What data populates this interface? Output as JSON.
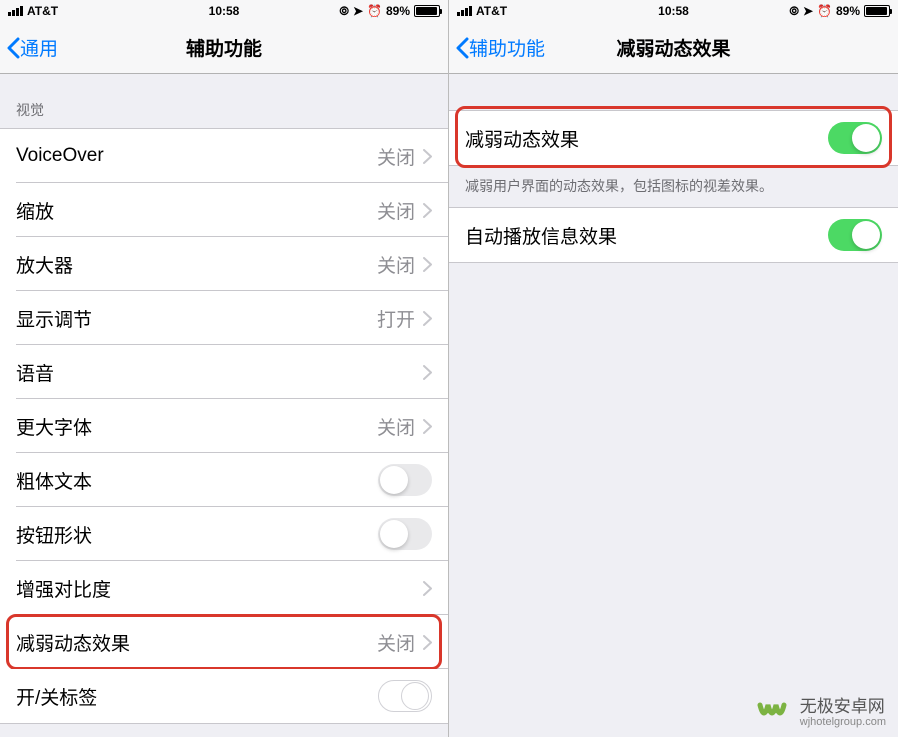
{
  "status": {
    "carrier": "AT&T",
    "time": "10:58",
    "battery_pct": "89%"
  },
  "left": {
    "back_label": "通用",
    "title": "辅助功能",
    "section": "视觉",
    "rows": [
      {
        "label": "VoiceOver",
        "value": "关闭",
        "type": "disclosure"
      },
      {
        "label": "缩放",
        "value": "关闭",
        "type": "disclosure"
      },
      {
        "label": "放大器",
        "value": "关闭",
        "type": "disclosure"
      },
      {
        "label": "显示调节",
        "value": "打开",
        "type": "disclosure"
      },
      {
        "label": "语音",
        "value": "",
        "type": "disclosure"
      },
      {
        "label": "更大字体",
        "value": "关闭",
        "type": "disclosure"
      },
      {
        "label": "粗体文本",
        "value": "",
        "type": "toggle",
        "on": false
      },
      {
        "label": "按钮形状",
        "value": "",
        "type": "toggle",
        "on": false
      },
      {
        "label": "增强对比度",
        "value": "",
        "type": "disclosure"
      },
      {
        "label": "减弱动态效果",
        "value": "关闭",
        "type": "disclosure",
        "highlight": true
      },
      {
        "label": "开/关标签",
        "value": "",
        "type": "toggle",
        "on": false,
        "outline": true
      }
    ]
  },
  "right": {
    "back_label": "辅助功能",
    "title": "减弱动态效果",
    "main_row": {
      "label": "减弱动态效果"
    },
    "footer": "减弱用户界面的动态效果，包括图标的视差效果。",
    "second_row": {
      "label": "自动播放信息效果"
    }
  },
  "watermark": {
    "cn": "无极安卓网",
    "en": "wjhotelgroup.com"
  },
  "icons": {
    "lock": "lock-icon",
    "location": "location-icon",
    "alarm": "alarm-icon"
  }
}
